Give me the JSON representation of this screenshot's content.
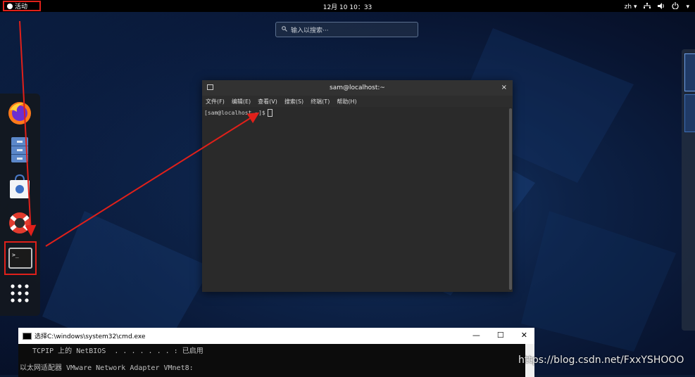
{
  "topbar": {
    "activities": "活动",
    "clock": "12月 10 10：33",
    "lang": "zh ▾",
    "status_icons": [
      "network-icon",
      "volume-icon",
      "power-icon"
    ]
  },
  "search": {
    "placeholder": "输入以搜索···"
  },
  "dash": {
    "items": [
      "firefox-icon",
      "files-icon",
      "software-icon",
      "help-icon",
      "terminal-icon",
      "show-apps-icon"
    ]
  },
  "terminal": {
    "title": "sam@localhost:~",
    "close": "×",
    "menu": [
      "文件(F)",
      "编辑(E)",
      "查看(V)",
      "搜索(S)",
      "终端(T)",
      "帮助(H)"
    ],
    "prompt": "[sam@localhost ~]$"
  },
  "cmd": {
    "title": "选择C:\\windows\\system32\\cmd.exe",
    "lines": [
      "   TCPIP 上的 NetBIOS  . . . . . . . : 已启用",
      "以太网适配器 VMware Network Adapter VMnet8:"
    ],
    "controls": [
      "—",
      "☐",
      "✕"
    ]
  },
  "watermark": "https://blog.csdn.net/FxxYSHOOO",
  "colors": {
    "annotation": "#e0201a",
    "desktop": "#0d2247"
  }
}
